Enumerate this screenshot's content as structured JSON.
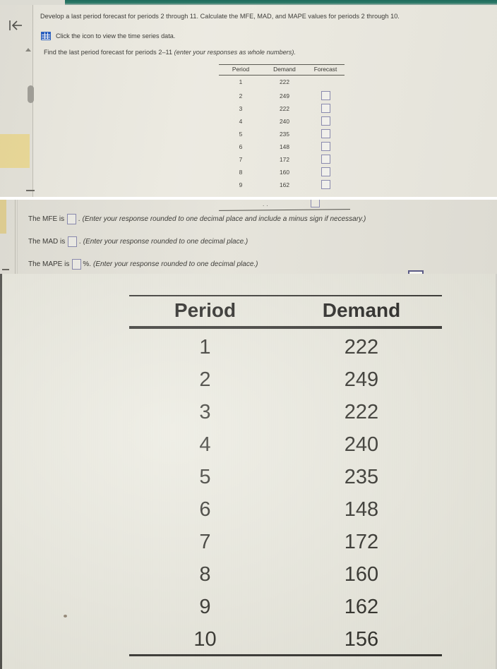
{
  "top_band": {
    "color": "#2d7a68"
  },
  "problem": {
    "statement": "Develop a last period forecast for periods 2 through 11. Calculate the MFE, MAD, and MAPE values for periods 2 through 10.",
    "icon_name": "spreadsheet-grid-icon",
    "icon_link_text": "Click the icon to view the time series data.",
    "instruction_plain": "Find the last period forecast for periods 2–11 ",
    "instruction_italic": "(enter your responses as whole numbers)."
  },
  "small_table": {
    "headers": [
      "Period",
      "Demand",
      "Forecast"
    ],
    "rows": [
      {
        "period": "1",
        "demand": "222",
        "forecast": ""
      },
      {
        "period": "2",
        "demand": "249",
        "forecast": ""
      },
      {
        "period": "3",
        "demand": "222",
        "forecast": ""
      },
      {
        "period": "4",
        "demand": "240",
        "forecast": ""
      },
      {
        "period": "5",
        "demand": "235",
        "forecast": ""
      },
      {
        "period": "6",
        "demand": "148",
        "forecast": ""
      },
      {
        "period": "7",
        "demand": "172",
        "forecast": ""
      },
      {
        "period": "8",
        "demand": "160",
        "forecast": ""
      },
      {
        "period": "9",
        "demand": "162",
        "forecast": ""
      }
    ]
  },
  "answers": {
    "mfe": {
      "lead": "The MFE is",
      "value": "",
      "tail": ". (Enter your response rounded to one decimal place and include a minus sign if necessary.)"
    },
    "mad": {
      "lead": "The MAD is",
      "value": "",
      "tail": ". (Enter your response rounded to one decimal place.)"
    },
    "mape": {
      "lead": "The MAPE is",
      "value": "",
      "percent": "%.",
      "tail": " (Enter your response rounded to one decimal place.)"
    }
  },
  "copy_icon": {
    "name": "copy-windows-icon"
  },
  "big_table": {
    "headers": [
      "Period",
      "Demand"
    ],
    "rows": [
      {
        "period": "1",
        "demand": "222"
      },
      {
        "period": "2",
        "demand": "249"
      },
      {
        "period": "3",
        "demand": "222"
      },
      {
        "period": "4",
        "demand": "240"
      },
      {
        "period": "5",
        "demand": "235"
      },
      {
        "period": "6",
        "demand": "148"
      },
      {
        "period": "7",
        "demand": "172"
      },
      {
        "period": "8",
        "demand": "160"
      },
      {
        "period": "9",
        "demand": "162"
      },
      {
        "period": "10",
        "demand": "156"
      }
    ]
  },
  "chart_data": {
    "type": "table",
    "title": "Time series data",
    "columns": [
      "Period",
      "Demand"
    ],
    "x": [
      1,
      2,
      3,
      4,
      5,
      6,
      7,
      8,
      9,
      10
    ],
    "values": [
      222,
      249,
      222,
      240,
      235,
      148,
      172,
      160,
      162,
      156
    ],
    "xlabel": "Period",
    "ylabel": "Demand"
  }
}
